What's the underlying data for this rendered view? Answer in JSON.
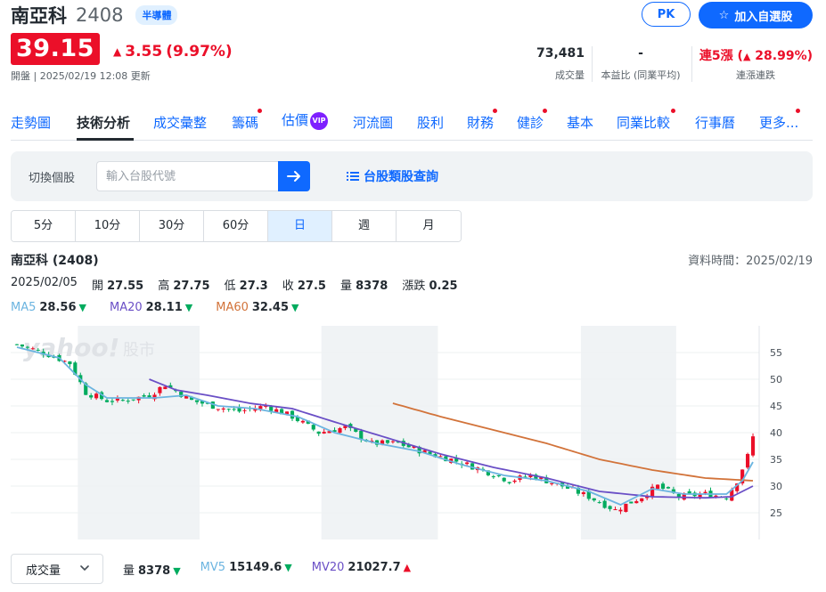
{
  "header": {
    "name": "南亞科",
    "code": "2408",
    "sector_tag": "半導體",
    "pk_label": "PK",
    "watchlist_label": "加入自選股"
  },
  "quote": {
    "price": "39.15",
    "change": "3.55",
    "change_pct": "(9.97%)",
    "market_status": "開盤 | 2025/02/19 12:08 更新"
  },
  "stats": {
    "volume": {
      "value": "73,481",
      "label": "成交量"
    },
    "pe": {
      "value": "-",
      "label": "本益比 (同業平均)"
    },
    "streak": {
      "value_main": "連5漲",
      "value_pct": "28.99%",
      "label": "連漲連跌"
    }
  },
  "tabs": [
    {
      "label": "走勢圖"
    },
    {
      "label": "技術分析"
    },
    {
      "label": "成交彙整"
    },
    {
      "label": "籌碼"
    },
    {
      "label": "估價"
    },
    {
      "label": "河流圖"
    },
    {
      "label": "股利"
    },
    {
      "label": "財務"
    },
    {
      "label": "健診"
    },
    {
      "label": "基本"
    },
    {
      "label": "同業比較"
    },
    {
      "label": "行事曆"
    },
    {
      "label": "更多..."
    }
  ],
  "vip_badge": "VIP",
  "search": {
    "label": "切換個股",
    "placeholder": "輸入台股代號",
    "category_link": "台股類股查詢"
  },
  "periods": [
    "5分",
    "10分",
    "30分",
    "60分",
    "日",
    "週",
    "月"
  ],
  "active_period": "日",
  "chart_header": {
    "title": "南亞科 (2408)",
    "data_time": "資料時間：2025/02/19",
    "date": "2025/02/05",
    "open_label": "開",
    "open": "27.55",
    "high_label": "高",
    "high": "27.75",
    "low_label": "低",
    "low": "27.3",
    "close_label": "收",
    "close": "27.5",
    "vol_label": "量",
    "vol": "8378",
    "chg_label": "漲跌",
    "chg": "0.25"
  },
  "ma": [
    {
      "label": "MA5",
      "value": "28.56",
      "color": "#6bb4e0"
    },
    {
      "label": "MA20",
      "value": "28.11",
      "color": "#6a4fc6"
    },
    {
      "label": "MA60",
      "value": "32.45",
      "color": "#d2733a"
    }
  ],
  "watermark": {
    "brand": "yahoo!",
    "suffix": "股市"
  },
  "volume_bar": {
    "select_label": "成交量",
    "vol_label": "量",
    "vol_value": "8378",
    "mv5_label": "MV5",
    "mv5_value": "15149.6",
    "mv20_label": "MV20",
    "mv20_value": "21027.7"
  },
  "colors": {
    "up": "#eb0f29",
    "down": "#00ab5e",
    "accent": "#0f69ff"
  },
  "chart_data": {
    "type": "line",
    "ylim": [
      20,
      60
    ],
    "yticks": [
      25,
      30,
      35,
      40,
      45,
      50,
      55
    ],
    "n_days": 140,
    "close_anchors": [
      [
        0,
        56.5
      ],
      [
        5,
        55
      ],
      [
        10,
        53
      ],
      [
        13,
        47.5
      ],
      [
        17,
        46
      ],
      [
        20,
        46
      ],
      [
        25,
        47
      ],
      [
        28,
        49
      ],
      [
        33,
        46
      ],
      [
        37,
        45
      ],
      [
        42,
        44
      ],
      [
        47,
        45
      ],
      [
        52,
        43
      ],
      [
        57,
        40
      ],
      [
        62,
        41
      ],
      [
        67,
        38
      ],
      [
        72,
        38
      ],
      [
        78,
        36
      ],
      [
        82,
        35
      ],
      [
        88,
        33
      ],
      [
        93,
        31
      ],
      [
        97,
        32
      ],
      [
        100,
        31
      ],
      [
        103,
        30
      ],
      [
        108,
        28
      ],
      [
        113,
        25.5
      ],
      [
        118,
        28
      ],
      [
        121,
        30
      ],
      [
        125,
        28
      ],
      [
        130,
        28.5
      ],
      [
        134,
        28
      ],
      [
        136,
        31
      ],
      [
        138,
        35.6
      ],
      [
        139,
        39.15
      ]
    ],
    "ma5_anchors": [
      [
        0,
        56
      ],
      [
        8,
        54
      ],
      [
        13,
        49
      ],
      [
        17,
        46.5
      ],
      [
        26,
        46.5
      ],
      [
        32,
        47
      ],
      [
        38,
        45
      ],
      [
        45,
        44.5
      ],
      [
        53,
        43
      ],
      [
        60,
        40
      ],
      [
        68,
        38
      ],
      [
        76,
        36.5
      ],
      [
        84,
        34
      ],
      [
        92,
        32
      ],
      [
        100,
        31
      ],
      [
        108,
        29
      ],
      [
        114,
        26.5
      ],
      [
        120,
        29.5
      ],
      [
        126,
        28.5
      ],
      [
        134,
        28.5
      ],
      [
        137,
        31
      ],
      [
        139,
        34.5
      ]
    ],
    "ma20_anchors": [
      [
        25,
        50
      ],
      [
        30,
        48
      ],
      [
        36,
        47
      ],
      [
        44,
        45.5
      ],
      [
        52,
        44.5
      ],
      [
        60,
        42
      ],
      [
        70,
        39
      ],
      [
        80,
        36
      ],
      [
        90,
        33.5
      ],
      [
        100,
        31.5
      ],
      [
        110,
        29
      ],
      [
        120,
        28
      ],
      [
        130,
        27.8
      ],
      [
        135,
        28
      ],
      [
        139,
        30
      ]
    ],
    "ma60_anchors": [
      [
        71,
        45.5
      ],
      [
        80,
        43
      ],
      [
        90,
        40.5
      ],
      [
        100,
        38
      ],
      [
        110,
        35
      ],
      [
        120,
        33
      ],
      [
        130,
        31.5
      ],
      [
        139,
        31
      ]
    ],
    "shaded_bands": [
      [
        12,
        35
      ],
      [
        58,
        80
      ],
      [
        107,
        125
      ]
    ]
  }
}
